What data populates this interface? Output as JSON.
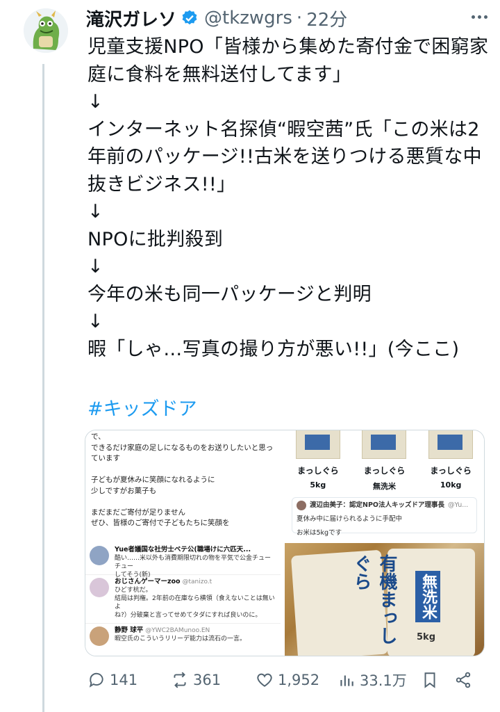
{
  "tweet": {
    "author_name": "滝沢ガレソ",
    "handle": "@tkzwgrs",
    "separator": "·",
    "time": "22分",
    "text": "児童支援NPO「皆様から集めた寄付金で困窮家庭に食料を無料送付してます」\n↓\nインターネット名探偵“暇空茜”氏「この米は2年前のパッケージ!!古米を送りつける悪質な中抜きビジネス!!」\n↓\nNPOに批判殺到\n↓\n今年の米も同一パッケージと判明\n↓\n暇「しゃ…写真の撮り方が悪い!!」(今ここ)",
    "hashtag": "#キッズドア"
  },
  "media": {
    "image1_text": "で、\nできるだけ家庭の足しになるものをお送りしたいと思っ\nています\n\n子どもが夏休みに笑顔になれるように\n少しですがお菓子も\n\nまだまだご寄付が足りません\nぜひ、皆様のご寄付で子どもたちに笑顔を\n\nご寄付はこちらから",
    "packages": [
      {
        "name": "まっしぐら",
        "sub": "5kg"
      },
      {
        "name": "まっしぐら",
        "sub": "無洗米"
      },
      {
        "name": "まっしぐら",
        "sub": "10kg"
      }
    ],
    "quote_author": "渡辺由美子：認定NPO法人キッズドア理事長",
    "quote_handle": "@Yu...",
    "quote_line1": "夏休み中に届けられるように手配中",
    "quote_line2": "お米は5kgです",
    "replies": [
      {
        "name": "Yue者議国な社労士ベテ公(職場けに六匹天...",
        "text": "酷い……米以外も消費期限切れの物を平気で公金チューチュー\nしてそう(新)"
      },
      {
        "name": "おじさんゲーマーzoo",
        "handle": "@tanizo.t",
        "text": "ひどす杭だ。\n結局は判権。2年前の在庫なら横領（食えないことは無いよ\nね?）分破棄と言ってせめてタダにすれば良いのに。"
      },
      {
        "name": "静野 球平",
        "handle": "@YWC2BAMunoo.EN",
        "text": "暇空氏のこういうリリーデ能力は流石の一言。"
      }
    ],
    "photo_text1": "有機まっしぐら",
    "photo_text2": "無洗米",
    "photo_text3": "5kg"
  },
  "actions": {
    "replies": "141",
    "retweets": "361",
    "likes": "1,952",
    "views": "33.1万"
  },
  "colors": {
    "link": "#1d9bf0",
    "verified": "#1d9bf0",
    "muted": "#536471",
    "line": "#cfd9de"
  }
}
